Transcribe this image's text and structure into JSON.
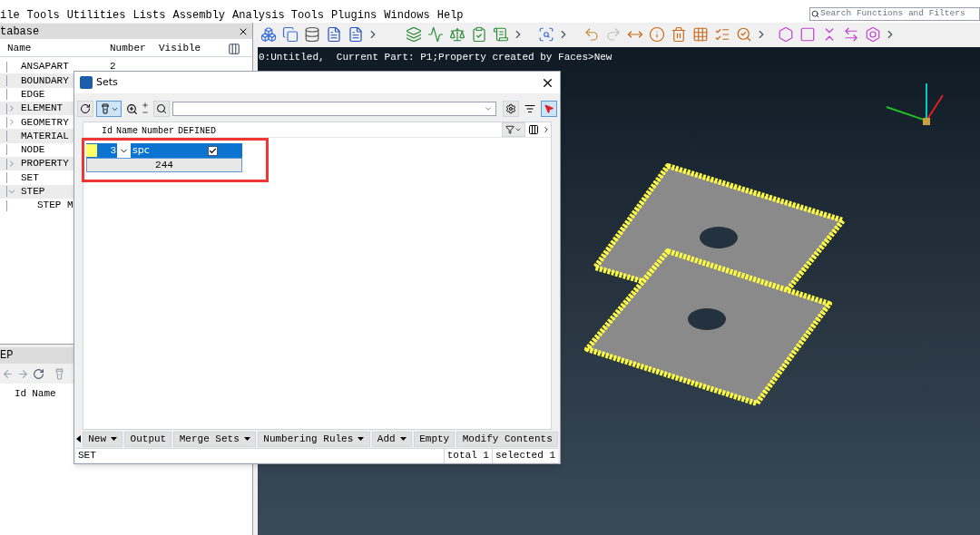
{
  "menu_bar": [
    "ile",
    "Tools",
    "Utilities",
    "Lists",
    "Assembly",
    "Analysis Tools",
    "Plugins",
    "Windows",
    "Help"
  ],
  "search": {
    "placeholder": "Search Functions and Filters"
  },
  "database_panel": {
    "title": "tabase",
    "columns": [
      "Name",
      "Number",
      "Visible"
    ],
    "items": [
      {
        "name": "ANSAPART",
        "number": "2"
      },
      {
        "name": "BOUNDARY"
      },
      {
        "name": "EDGE"
      },
      {
        "name": "ELEMENT",
        "expanded": false
      },
      {
        "name": "GEOMETRY",
        "expanded": false
      },
      {
        "name": "MATERIAL"
      },
      {
        "name": "NODE"
      },
      {
        "name": "PROPERTY",
        "expanded": false
      },
      {
        "name": "SET"
      },
      {
        "name": "STEP",
        "expanded": true,
        "children": [
          {
            "name": "STEP M"
          }
        ]
      }
    ]
  },
  "step_panel": {
    "title": "EP",
    "columns": [
      "Id",
      "Name"
    ]
  },
  "viewport": {
    "status": "0:Untitled,  Current Part: P1;Property created by Faces>New"
  },
  "sets_dialog": {
    "title": "Sets",
    "columns": [
      "Id",
      "Name",
      "Number",
      "DEFINED"
    ],
    "highlight_box": true,
    "rows": [
      {
        "color": "#ffff66",
        "id": "3",
        "name": "spc",
        "defined": true,
        "selected": true,
        "number": "244"
      }
    ],
    "buttons": [
      {
        "label": "New",
        "dropdown": true
      },
      {
        "label": "Output",
        "dropdown": false
      },
      {
        "label": "Merge Sets",
        "dropdown": true
      },
      {
        "label": "Numbering Rules",
        "dropdown": true
      },
      {
        "label": "Add",
        "dropdown": true
      },
      {
        "label": "Empty",
        "dropdown": false
      },
      {
        "label": "Modify Contents",
        "dropdown": false
      }
    ],
    "status_bar": {
      "type": "SET",
      "total": "total 1",
      "selected": "selected 1"
    }
  }
}
